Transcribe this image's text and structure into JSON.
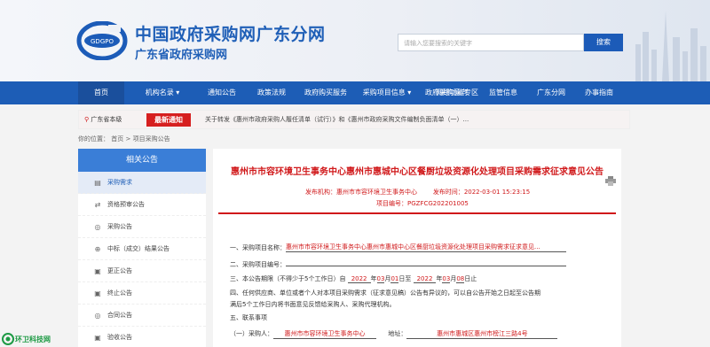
{
  "header": {
    "title": "中国政府采购网广东分网",
    "subtitle": "广东省政府采购网",
    "logo_text": "GDGPO",
    "search_placeholder": "请输入您要搜索的关键字",
    "search_button": "搜索"
  },
  "nav": {
    "items": [
      {
        "label": "首页"
      },
      {
        "label": "机构名录 ▾"
      },
      {
        "label": "通知公告"
      },
      {
        "label": "政策法规"
      },
      {
        "label": "政府购买服务"
      },
      {
        "label": "采购项目信息 ▾"
      },
      {
        "label": "政府采购意向"
      },
      {
        "label": "网络功能专区"
      },
      {
        "label": "监管信息"
      },
      {
        "label": "广东分网"
      },
      {
        "label": "办事指南"
      }
    ]
  },
  "notice": {
    "location": "广东省本级",
    "tag": "最新通知",
    "text": "关于转发《惠州市政府采购人履任清单（试行）》和《惠州市政府采购文件编制负面清单（一）..."
  },
  "breadcrumb": {
    "prefix": "你的位置：",
    "home": "首页",
    "sep": ">",
    "current": "项目采购公告"
  },
  "sidebar": {
    "title": "相关公告",
    "items": [
      {
        "label": "采购需求",
        "icon": "▤"
      },
      {
        "label": "资格预审公告",
        "icon": "⇄"
      },
      {
        "label": "采购公告",
        "icon": "◎"
      },
      {
        "label": "中标（成交）结果公告",
        "icon": "⊕"
      },
      {
        "label": "更正公告",
        "icon": "▣"
      },
      {
        "label": "终止公告",
        "icon": "▣"
      },
      {
        "label": "合同公告",
        "icon": "◎"
      },
      {
        "label": "验收公告",
        "icon": "▣"
      }
    ]
  },
  "article": {
    "title": "惠州市市容环境卫生事务中心惠州市惠城中心区餐厨垃圾资源化处理项目采购需求征求意见公告",
    "publisher_label": "发布机构：",
    "publisher": "惠州市市容环境卫生事务中心",
    "publish_time_label": "发布时间：",
    "publish_time": "2022-03-01 15:23:15",
    "project_no_label": "项目编号：",
    "project_no": "PGZFCG202201005",
    "s1_label": "一、采购项目名称：",
    "s1_value": "惠州市市容环境卫生事务中心惠州市惠城中心区餐厨垃圾资源化处理项目采购需求征求意见...",
    "s2_label": "二、采购项目编号：",
    "s3_a": "三、本公告期限（不得少于5个工作日）自",
    "s3_y1": "2022",
    "s3_y1u": "年",
    "s3_m1": "03",
    "s3_m1u": "月",
    "s3_d1": "01",
    "s3_d1u": "日至",
    "s3_y2": "2022",
    "s3_y2u": "年",
    "s3_m2": "03",
    "s3_m2u": "月",
    "s3_d2": "08",
    "s3_d2u": "日止",
    "s4_line1": "四、任何供应商、单位或者个人对本项目采购需求（征求意见稿）公告有异议的，可以自公告开始之日起至公告期",
    "s4_line2": "满后5个工作日内将书面意见反馈给采购人、采购代理机构。",
    "s5": "五、联系事项",
    "s5_1_label": "（一）采购人：",
    "s5_1_value": "惠州市市容环境卫生事务中心",
    "s5_addr_label": "地址：",
    "s5_addr_value": "惠州市惠城区惠州市榜江三路4号"
  },
  "watermark": {
    "text": "环卫科技网"
  },
  "colors": {
    "brand_blue": "#1d5db6",
    "accent_red": "#d0181a",
    "sidebar_head": "#3a7ed7"
  }
}
